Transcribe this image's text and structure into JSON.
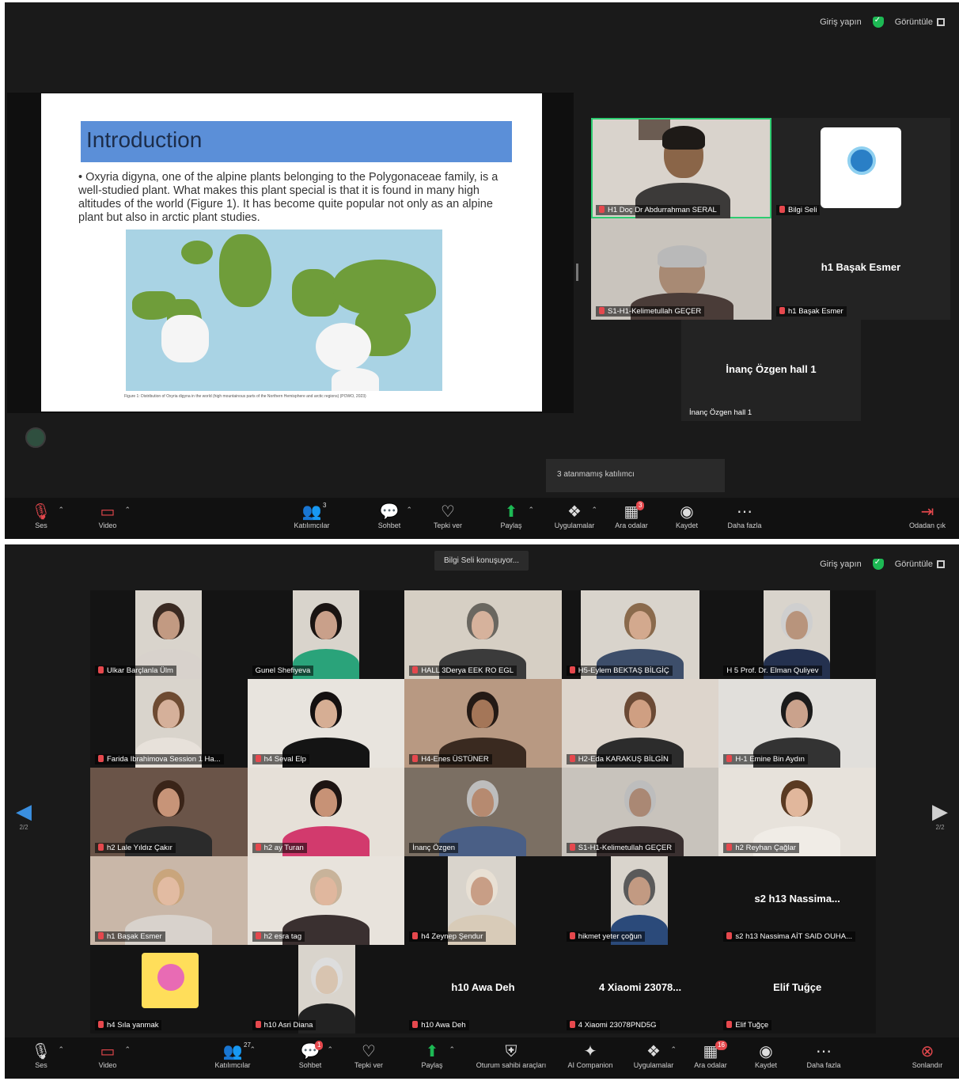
{
  "top_bar": {
    "sign_in": "Giriş yapın",
    "view": "Görüntüle"
  },
  "slide": {
    "title": "Introduction",
    "body": "• Oxyria digyna, one of the alpine plants belonging to the Polygonaceae family, is a well-studied plant. What makes this plant special is that it is found in many high altitudes of the world (Figure 1). It has become quite popular not only as an alpine plant but also in arctic plant studies.",
    "caption": "Figure 1: Distribution of Oxyria digyna in the world (high mountainous parts of the Northern Hemisphere and arctic regions) (POWO, 2023)"
  },
  "panel1_tiles": {
    "t1": "H1 Doç Dr Abdurrahman SERAL",
    "t2": "Bilgi Seli",
    "t3": "S1-H1-Kelimetullah GEÇER",
    "t4_big": "h1 Başak Esmer",
    "t4": "h1 Başak Esmer",
    "t5_big": "İnanç Özgen hall 1",
    "t5": "İnanç Özgen hall 1"
  },
  "pager": "3 atanmamış katılımcı",
  "toolbar1": {
    "audio": "Ses",
    "video": "Video",
    "participants": "Katılımcılar",
    "participants_count": "3",
    "chat": "Sohbet",
    "reactions": "Tepki ver",
    "share": "Paylaş",
    "apps": "Uygulamalar",
    "rooms": "Ara odalar",
    "rooms_badge": "3",
    "record": "Kaydet",
    "more": "Daha fazla",
    "leave": "Odadan çık"
  },
  "speaking": "Bilgi Seli konuşuyor...",
  "grid_tiles": [
    "Ulkar Barçlanla Ülm",
    "Gunel Shefiyeva",
    "HALL 3Derya EEK RO EGL",
    "H5-Eylem BEKTAŞ BİLGİÇ",
    "H 5 Prof. Dr. Elman Quliyev",
    "Farida Ibrahimova Session 1 Ha...",
    "h4 Seval Elp",
    "H4-Enes ÜSTÜNER",
    "H2-Eda KARAKUŞ BİLGİN",
    "H-1 Emine Bin Aydın",
    "h2 Lale Yıldız Çakır",
    "h2 ay Turan",
    "İnanç Özgen",
    "S1-H1-Kelimetullah GEÇER",
    "h2 Reyhan Çağlar",
    "h1 Başak Esmer",
    "h2 esra tag",
    "h4 Zeynep Şendur",
    "hikmet yeter çoğun",
    "s2 h13 Nassima AİT SAID OUHA...",
    "h4 Sıla yanmak",
    "h10 Asri Diana",
    "h10 Awa Deh",
    "4 Xiaomi 23078PND5G",
    "Elif Tuğçe"
  ],
  "grid_big": {
    "nassima": "s2 h13 Nassima...",
    "awa": "h10 Awa Deh",
    "xiaomi": "4 Xiaomi 23078...",
    "elif": "Elif Tuğçe"
  },
  "page_indicator": {
    "left": "2/2",
    "right": "2/2"
  },
  "toolbar2": {
    "audio": "Ses",
    "video": "Video",
    "participants": "Katılımcılar",
    "participants_count": "27",
    "chat": "Sohbet",
    "chat_badge": "1",
    "reactions": "Tepki ver",
    "share": "Paylaş",
    "host_tools": "Oturum sahibi araçları",
    "ai": "AI Companion",
    "apps": "Uygulamalar",
    "rooms": "Ara odalar",
    "rooms_badge": "16",
    "record": "Kaydet",
    "more": "Daha fazla",
    "end": "Sonlandır"
  },
  "colors": {
    "accent": "#1db954",
    "alert": "#e5484d",
    "slide_title_bg": "#5b8fd8"
  }
}
